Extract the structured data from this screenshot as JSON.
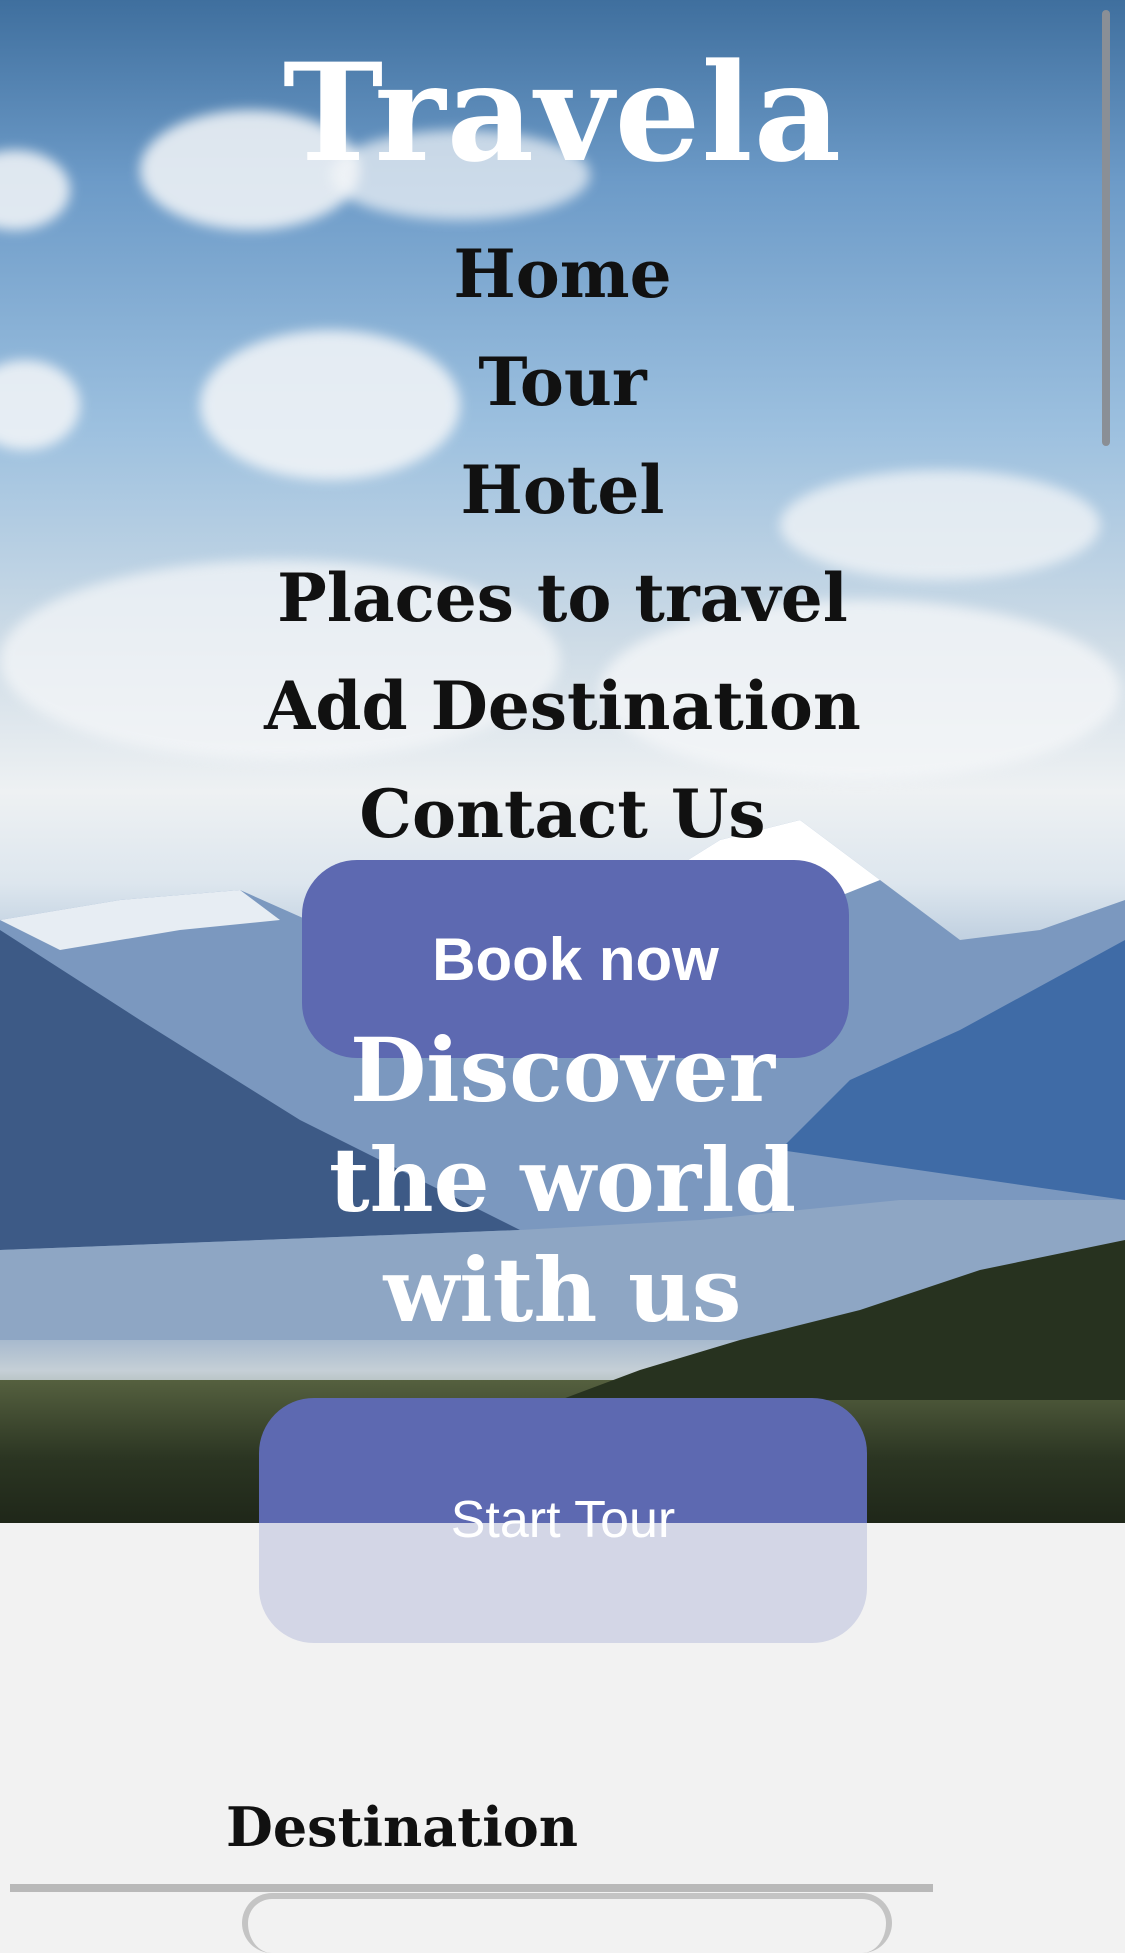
{
  "header": {
    "brand": "Travela"
  },
  "nav": {
    "items": [
      {
        "label": "Home"
      },
      {
        "label": "Tour"
      },
      {
        "label": "Hotel"
      },
      {
        "label": "Places to travel"
      },
      {
        "label": "Add Destination"
      },
      {
        "label": "Contact Us"
      }
    ]
  },
  "hero": {
    "book_label": "Book now",
    "headline_lines": [
      "Discover",
      "the world",
      "with us"
    ],
    "start_label": "Start Tour"
  },
  "section": {
    "title": "Destination"
  },
  "colors": {
    "accent": "#5d69b1",
    "accent_light": "#d3d6e6",
    "background": "#f2f2f2"
  }
}
